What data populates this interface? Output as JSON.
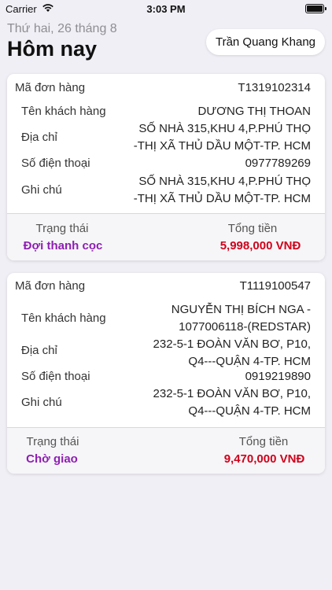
{
  "status_bar": {
    "carrier": "Carrier",
    "time": "3:03 PM"
  },
  "header": {
    "date": "Thứ hai, 26 tháng 8",
    "title": "Hôm nay",
    "user": "Trần Quang Khang"
  },
  "labels": {
    "order_id": "Mã đơn hàng",
    "customer": "Tên khách hàng",
    "address": "Địa chỉ",
    "phone": "Số điện thoại",
    "note": "Ghi chú",
    "status": "Trạng thái",
    "total": "Tổng tiền"
  },
  "orders": [
    {
      "id": "T1319102314",
      "customer": [
        "DƯƠNG THỊ THOAN"
      ],
      "address": [
        "SỐ NHÀ 315,KHU 4,P.PHÚ THỌ",
        "-THỊ XÃ THỦ DẦU MỘT-TP. HCM"
      ],
      "phone": "0977789269",
      "note": [
        "SỐ NHÀ 315,KHU 4,P.PHÚ THỌ",
        "-THỊ XÃ THỦ DẦU MỘT-TP. HCM"
      ],
      "status": "Đợi thanh cọc",
      "total": "5,998,000 VNĐ"
    },
    {
      "id": "T1119100547",
      "customer": [
        "NGUYỄN THỊ BÍCH NGA -",
        "1077006118-(REDSTAR)"
      ],
      "address": [
        "232-5-1 ĐOÀN VĂN BƠ, P10,",
        "Q4---QUẬN 4-TP. HCM"
      ],
      "phone": "0919219890",
      "note": [
        "232-5-1 ĐOÀN VĂN BƠ, P10,",
        "Q4---QUẬN 4-TP. HCM"
      ],
      "status": "Chờ giao",
      "total": "9,470,000 VNĐ"
    }
  ]
}
